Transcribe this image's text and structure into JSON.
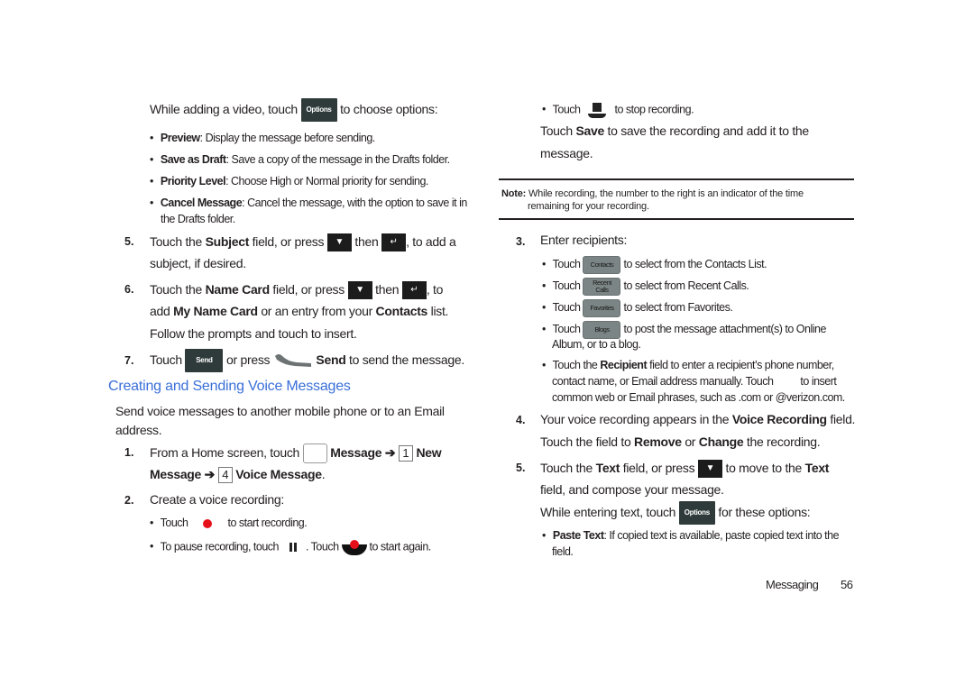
{
  "left_column": {
    "video_options_intro": {
      "pre": "While adding a video, touch",
      "button": "Options",
      "post": "to choose options:"
    },
    "video_options": [
      {
        "term": "Preview",
        "desc": ": Display the message before sending."
      },
      {
        "term": "Save as Draft",
        "desc": ": Save a copy of the message in the Drafts folder."
      },
      {
        "term": "Priority Level",
        "desc": ": Choose High or Normal priority for sending."
      },
      {
        "term": "Cancel Message",
        "desc": ": Cancel the message, with the option to save it in",
        "desc2": "the Drafts folder."
      }
    ],
    "step5": {
      "num": "5.",
      "a": "Touch the",
      "b": "Subject",
      "c": "field, or press",
      "d": "then",
      "e": ", to add a",
      "line2": "subject, if desired."
    },
    "step6": {
      "num": "6.",
      "a": "Touch the",
      "b": "Name Card",
      "c": "field, or press",
      "d": "then",
      "e": ", to",
      "l2a": "add",
      "l2b": "My Name Card",
      "l2c": "or an entry from your",
      "l2d": "Contacts",
      "l2e": "list.",
      "line3": "Follow the prompts and touch to insert."
    },
    "step7": {
      "num": "7.",
      "a": "Touch",
      "button": "Send",
      "b": "or press",
      "c": "Send",
      "d": "to send the message."
    },
    "section_heading": "Creating and Sending Voice Messages",
    "intro": {
      "line1": "Send voice messages to another mobile phone or to an Email",
      "line2": "address."
    },
    "vstep1": {
      "num": "1.",
      "a": "From a Home screen, touch",
      "b": "Message",
      "arrow": "➔",
      "key1": "1",
      "c": "New",
      "l2a": "Message",
      "key2": "4",
      "l2b": "Voice Message",
      "l2c": "."
    },
    "vstep2": {
      "num": "2.",
      "text": "Create a voice recording:"
    },
    "rec_bullets": [
      {
        "a": "Touch",
        "b": "to start recording."
      },
      {
        "a": "To pause recording, touch",
        "b": ". Touch",
        "c": "to start again."
      }
    ]
  },
  "right_column": {
    "stop_bullet": {
      "a": "Touch",
      "b": "to stop recording."
    },
    "save_text": {
      "a": "Touch",
      "b": "Save",
      "c": "to save the recording and add it to the",
      "line2": "message."
    },
    "note": {
      "label": "Note:",
      "line1": "While recording, the number to the right is an indicator of the time",
      "line2": "remaining for your recording."
    },
    "step3": {
      "num": "3.",
      "text": "Enter recipients:"
    },
    "recipient_bullets": [
      {
        "a": "Touch",
        "button": "Contacts",
        "b": "to select from the Contacts List."
      },
      {
        "a": "Touch",
        "button": "Recent Calls",
        "b": "to select from Recent Calls."
      },
      {
        "a": "Touch",
        "button": "Favorites",
        "b": "to select from Favorites."
      },
      {
        "a": "Touch",
        "button": "Blogs",
        "b": "to post  the message attachment(s) to Online",
        "line2": "Album, or to a blog."
      }
    ],
    "recipient_field": {
      "a": "Touch the",
      "b": "Recipient",
      "c": "field to enter a recipient’s phone number,",
      "line2a": "contact name, or Email address manually. Touch",
      "line2b": "to insert",
      "line3": "common web or Email phrases, such as .com or @verizon.com."
    },
    "step4": {
      "num": "4.",
      "a": "Your voice recording appears in the",
      "b": "Voice Recording",
      "c": "field.",
      "l2a": "Touch the field to",
      "l2b": "Remove",
      "l2c": "or",
      "l2d": "Change",
      "l2e": "the recording."
    },
    "step5": {
      "num": "5.",
      "a": "Touch the",
      "b": "Text",
      "c": "field, or press",
      "d": "to move to the",
      "e": "Text",
      "line2": "field, and compose your message.",
      "l3a": "While entering text, touch",
      "button": "Options",
      "l3b": "for these options:"
    },
    "paste_text": {
      "term": "Paste Text",
      "desc": ": If copied text is available, paste copied text into the",
      "line2": "field."
    }
  },
  "footer": {
    "section": "Messaging",
    "page": "56"
  },
  "colors": {
    "heading": "#3a6fd8",
    "record_red": "#e6101a",
    "options_button": "#2e3b3a",
    "gray_button": "#7c8585"
  }
}
